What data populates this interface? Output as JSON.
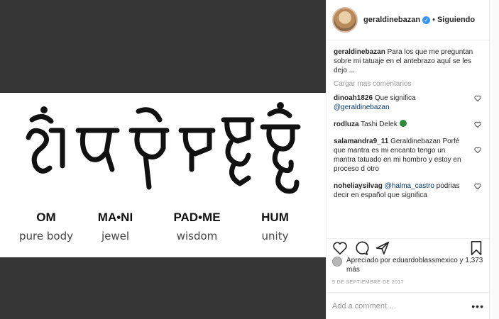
{
  "post": {
    "username": "geraldinebazan",
    "separator": "•",
    "follow_status": "Siguiendo"
  },
  "image": {
    "mantra": [
      {
        "word": "OM",
        "meaning": "pure body"
      },
      {
        "word": "MA•NI",
        "meaning": "jewel"
      },
      {
        "word": "PAD•ME",
        "meaning": "wisdom"
      },
      {
        "word": "HUM",
        "meaning": "unity"
      }
    ]
  },
  "caption": {
    "username": "geraldinebazan",
    "text": "Para los que me preguntan sobre mi tatuaje en el antebrazo aquí se les dejo ..."
  },
  "load_more": "Cargar mas comentarios",
  "comments": [
    {
      "username": "dinoah1826",
      "text": "Que significa",
      "mention": "@geraldinebazan"
    },
    {
      "username": "rodluza",
      "text": "Tashi Delek"
    },
    {
      "username": "salamandra9_11",
      "text": "Geraldinebazan Porfé que mantra es mi encanto tengo un mantra tatuado en mi hombro y estoy en proceso d otro"
    },
    {
      "username": "noheliaysilvag",
      "mention": "@halma_castro",
      "text": "podrias decir en español que significa"
    }
  ],
  "likes": {
    "text": "Apreciado por eduardoblassmexico y 1,373 más"
  },
  "timestamp": "5 DE SEPTIEMBRE DE 2017",
  "add_comment": {
    "placeholder": "Add a comment...",
    "more": "•••"
  },
  "colors": {
    "backdrop": "#363636",
    "mention": "#003569",
    "verified": "#3897f0"
  },
  "icons": [
    "verified-icon",
    "heart-icon",
    "comment-icon",
    "share-icon",
    "bookmark-icon",
    "clover-emoji"
  ]
}
